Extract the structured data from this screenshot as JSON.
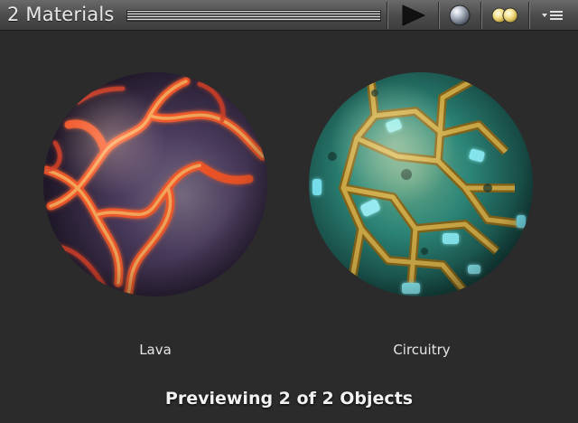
{
  "header": {
    "title": "2 Materials",
    "buttons": [
      {
        "name": "play-button",
        "icon": "play-icon"
      },
      {
        "name": "sphere-mesh-button",
        "icon": "sphere-icon"
      },
      {
        "name": "light-toggle-button",
        "icon": "two-lights-icon"
      },
      {
        "name": "options-menu-button",
        "icon": "dropdown-menu-icon"
      }
    ]
  },
  "previews": [
    {
      "label": "Lava",
      "material": "lava-material-sphere"
    },
    {
      "label": "Circuitry",
      "material": "circuitry-material-sphere"
    }
  ],
  "status": {
    "text": "Previewing 2 of 2 Objects"
  },
  "colors": {
    "background": "#2b2b2b",
    "lava_base": "#4a3a5c",
    "lava_glow": "#ff5a2a",
    "circuit_base": "#2e8a7e",
    "circuit_trace": "#c9a23a",
    "circuit_light": "#5ff0ff"
  }
}
